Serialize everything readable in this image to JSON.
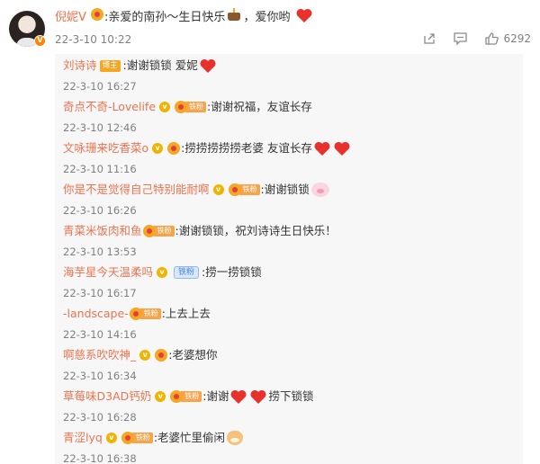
{
  "post": {
    "author": "倪妮V",
    "text": ":亲爱的南孙～生日快乐",
    "text_end": "，爱你哟",
    "time": "22-3-10 10:22",
    "like_count": "6292"
  },
  "replies": [
    {
      "name": "刘诗诗",
      "badge": "bozhu",
      "badge_label": "博主",
      "text": ":谢谢锁锁 爱妮",
      "emoji": [
        "heart"
      ],
      "time": "22-3-10 16:27"
    },
    {
      "name": "奇点不奇-Lovelife",
      "verified": true,
      "badge": "fan",
      "badge_label": "铁粉",
      "text": ":谢谢祝福，友谊长存",
      "emoji": [],
      "time": "22-3-10 12:46"
    },
    {
      "name": "文咏珊来吃香菜o",
      "verified": true,
      "badge": "small",
      "text": ":捞捞捞捞捞老婆 友谊长存",
      "emoji": [
        "heart",
        "heart"
      ],
      "time": "22-3-10 11:16"
    },
    {
      "name": "你是不是觉得自己特别能耐啊",
      "verified": true,
      "badge": "fan",
      "badge_label": "铁粉",
      "text": ":谢谢锁锁",
      "emoji": [
        "pig"
      ],
      "time": "22-3-10 16:26"
    },
    {
      "name": "青菜米饭肉和鱼",
      "verified": false,
      "badge": "fan",
      "badge_label": "铁粉",
      "text": ":谢谢锁锁，祝刘诗诗生日快乐！",
      "emoji": [],
      "time": "22-3-10 13:53"
    },
    {
      "name": "海芋星今天温柔吗",
      "verified": true,
      "badge": "blue",
      "badge_label": "铁粉",
      "text": ":捞一捞锁锁",
      "emoji": [],
      "time": "22-3-10 16:17"
    },
    {
      "name": "-landscape-",
      "verified": false,
      "badge": "fan",
      "badge_label": "铁粉",
      "text": ":上去上去",
      "emoji": [],
      "time": "22-3-10 14:16"
    },
    {
      "name": "啊慈系吹吹神_",
      "verified": true,
      "badge": "small",
      "text": ":老婆想你",
      "emoji": [],
      "time": "22-3-10 16:34"
    },
    {
      "name": "草莓味D3AD钙奶",
      "verified": true,
      "badge": "fan",
      "badge_label": "铁粉",
      "text": ":谢谢",
      "text2": "捞下锁锁",
      "emoji": [
        "heart",
        "heart"
      ],
      "time": "22-3-10 16:28"
    },
    {
      "name": "青涩lyq",
      "verified": true,
      "badge": "fan",
      "badge_label": "铁粉",
      "text": ":老婆忙里偷闲",
      "emoji": [
        "cat"
      ],
      "time": "22-3-10 16:38"
    }
  ],
  "colors": {
    "name": "#eb7350",
    "heart": "#e8312c",
    "reply_bg": "#f7f7f7"
  },
  "icons": {
    "share": "share-icon",
    "comment": "comment-icon",
    "like": "thumb-up-icon"
  }
}
